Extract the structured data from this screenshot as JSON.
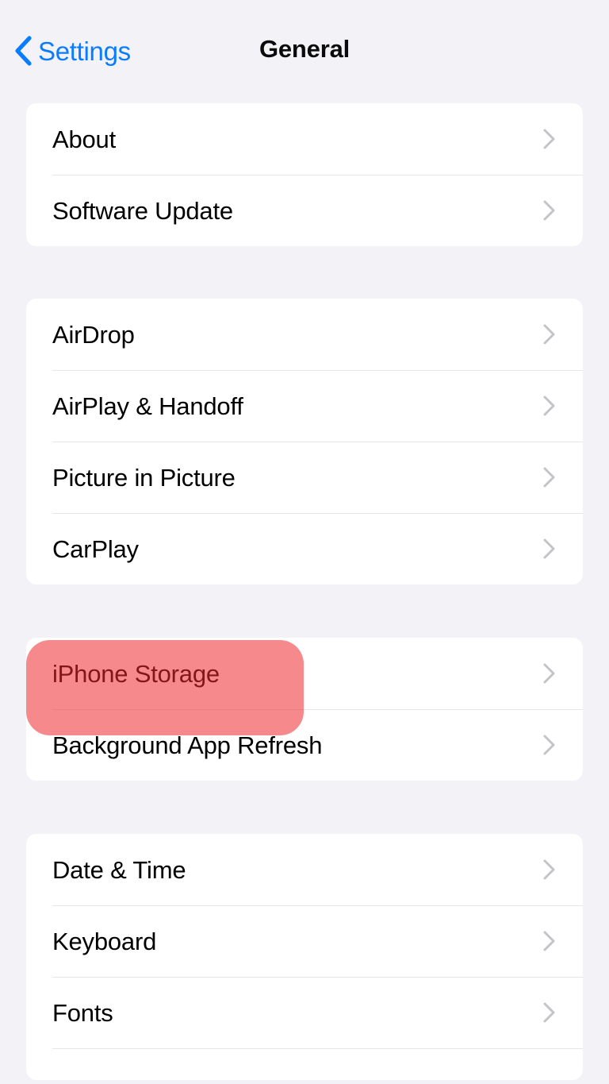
{
  "header": {
    "back_label": "Settings",
    "title": "General",
    "back_icon": "chevron-left-icon",
    "accent_color": "#0A7CFF",
    "title_color": "#0B0B0C"
  },
  "theme": {
    "page_background": "#F2F2F7",
    "card_background": "#FFFFFF",
    "separator_color": "#E6E6EA",
    "chevron_color": "#C4C4C8",
    "highlight_color": "rgba(237, 40, 43, 0.55)"
  },
  "sections": [
    {
      "rows": [
        {
          "label": "About",
          "accessory": "chevron-right-icon"
        },
        {
          "label": "Software Update",
          "accessory": "chevron-right-icon"
        }
      ]
    },
    {
      "rows": [
        {
          "label": "AirDrop",
          "accessory": "chevron-right-icon"
        },
        {
          "label": "AirPlay & Handoff",
          "accessory": "chevron-right-icon"
        },
        {
          "label": "Picture in Picture",
          "accessory": "chevron-right-icon"
        },
        {
          "label": "CarPlay",
          "accessory": "chevron-right-icon"
        }
      ]
    },
    {
      "rows": [
        {
          "label": "iPhone Storage",
          "accessory": "chevron-right-icon",
          "highlighted": true
        },
        {
          "label": "Background App Refresh",
          "accessory": "chevron-right-icon"
        }
      ]
    },
    {
      "rows": [
        {
          "label": "Date & Time",
          "accessory": "chevron-right-icon"
        },
        {
          "label": "Keyboard",
          "accessory": "chevron-right-icon"
        },
        {
          "label": "Fonts",
          "accessory": "chevron-right-icon"
        }
      ]
    }
  ],
  "annotation": {
    "target_label": "iPhone Storage",
    "shape": "rounded-rectangle"
  }
}
